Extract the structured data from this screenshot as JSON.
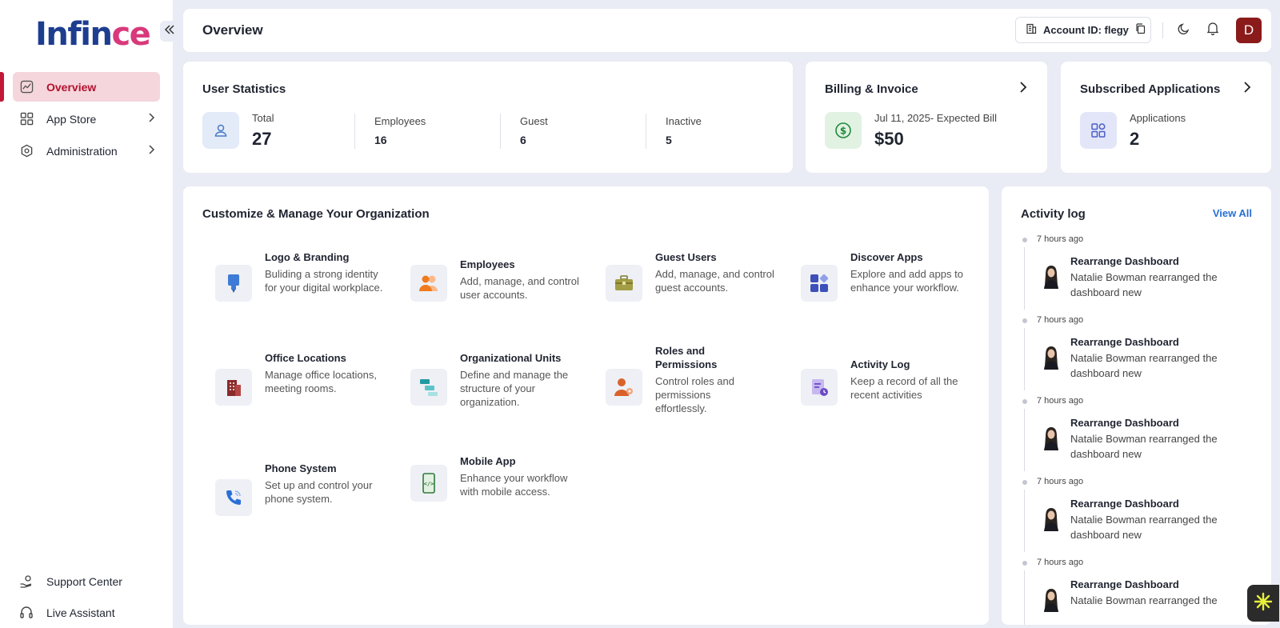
{
  "brand": {
    "part1": "Infin",
    "part2": "ce"
  },
  "sidebar": {
    "items": [
      {
        "label": "Overview"
      },
      {
        "label": "App Store"
      },
      {
        "label": "Administration"
      }
    ],
    "bottom": [
      {
        "label": "Support Center"
      },
      {
        "label": "Live Assistant"
      }
    ]
  },
  "header": {
    "title": "Overview",
    "account_label": "Account ID: flegy",
    "avatar_initial": "D"
  },
  "user_stats": {
    "title": "User Statistics",
    "total_label": "Total",
    "total_value": "27",
    "employees_label": "Employees",
    "employees_value": "16",
    "guest_label": "Guest",
    "guest_value": "6",
    "inactive_label": "Inactive",
    "inactive_value": "5"
  },
  "billing": {
    "title": "Billing & Invoice",
    "label": "Jul 11, 2025- Expected Bill",
    "amount": "$50"
  },
  "subscribed": {
    "title": "Subscribed Applications",
    "label": "Applications",
    "value": "2"
  },
  "customize": {
    "title": "Customize & Manage Your Organization",
    "tiles": [
      {
        "title": "Logo & Branding",
        "desc": "Buliding a strong identity for your digital workplace."
      },
      {
        "title": "Employees",
        "desc": "Add, manage, and control user accounts."
      },
      {
        "title": "Guest Users",
        "desc": "Add, manage, and control guest accounts."
      },
      {
        "title": "Discover Apps",
        "desc": "Explore and add apps to enhance your workflow."
      },
      {
        "title": "Office Locations",
        "desc": "Manage office locations, meeting rooms."
      },
      {
        "title": "Organizational Units",
        "desc": "Define and manage the structure of your organization."
      },
      {
        "title": "Roles and Permissions",
        "desc": "Control roles and permissions effortlessly."
      },
      {
        "title": "Activity Log",
        "desc": "Keep a record of all the recent activities"
      },
      {
        "title": "Phone System",
        "desc": "Set up and control your phone system."
      },
      {
        "title": "Mobile App",
        "desc": "Enhance your workflow with mobile access."
      }
    ]
  },
  "activity": {
    "title": "Activity log",
    "view_all": "View All",
    "items": [
      {
        "time": "7 hours ago",
        "title": "Rearrange Dashboard",
        "desc": "Natalie Bowman rearranged the dashboard new"
      },
      {
        "time": "7 hours ago",
        "title": "Rearrange Dashboard",
        "desc": "Natalie Bowman rearranged the dashboard new"
      },
      {
        "time": "7 hours ago",
        "title": "Rearrange Dashboard",
        "desc": "Natalie Bowman rearranged the dashboard new"
      },
      {
        "time": "7 hours ago",
        "title": "Rearrange Dashboard",
        "desc": "Natalie Bowman rearranged the dashboard new"
      },
      {
        "time": "7 hours ago",
        "title": "Rearrange Dashboard",
        "desc": "Natalie Bowman rearranged the"
      }
    ]
  },
  "colors": {
    "accent": "#c21838",
    "brand_blue": "#1d3d8f",
    "brand_pink": "#d8397a",
    "link": "#2a6fd6"
  }
}
